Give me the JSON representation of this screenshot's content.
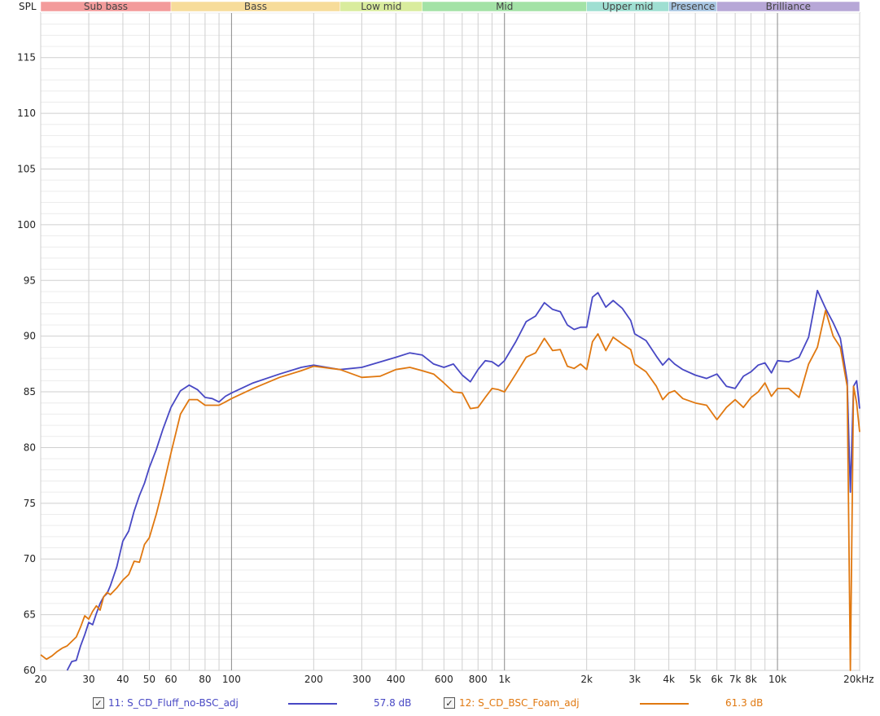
{
  "chart_data": {
    "type": "line",
    "ylabel": "SPL",
    "x_scale": "log",
    "xlim": [
      20,
      20000
    ],
    "ylim": [
      60,
      119
    ],
    "yticks": [
      60,
      65,
      70,
      75,
      80,
      85,
      90,
      95,
      100,
      105,
      110,
      115
    ],
    "xticks": [
      {
        "value": 20,
        "label": "20"
      },
      {
        "value": 30,
        "label": "30"
      },
      {
        "value": 40,
        "label": "40"
      },
      {
        "value": 50,
        "label": "50"
      },
      {
        "value": 60,
        "label": "60"
      },
      {
        "value": 80,
        "label": "80"
      },
      {
        "value": 100,
        "label": "100"
      },
      {
        "value": 200,
        "label": "200"
      },
      {
        "value": 300,
        "label": "300"
      },
      {
        "value": 400,
        "label": "400"
      },
      {
        "value": 600,
        "label": "600"
      },
      {
        "value": 800,
        "label": "800"
      },
      {
        "value": 1000,
        "label": "1k"
      },
      {
        "value": 2000,
        "label": "2k"
      },
      {
        "value": 3000,
        "label": "3k"
      },
      {
        "value": 4000,
        "label": "4k"
      },
      {
        "value": 5000,
        "label": "5k"
      },
      {
        "value": 6000,
        "label": "6k"
      },
      {
        "value": 7000,
        "label": "7k"
      },
      {
        "value": 8000,
        "label": "8k"
      },
      {
        "value": 10000,
        "label": "10k"
      },
      {
        "value": 20000,
        "label": "20kHz"
      }
    ],
    "grid": true,
    "bands": [
      {
        "label": "Sub bass",
        "from": 20,
        "to": 60,
        "color": "#f39b9b"
      },
      {
        "label": "Bass",
        "from": 60,
        "to": 250,
        "color": "#f7dc9a"
      },
      {
        "label": "Low mid",
        "from": 250,
        "to": 500,
        "color": "#d9ec9d"
      },
      {
        "label": "Mid",
        "from": 500,
        "to": 2000,
        "color": "#a3e2a6"
      },
      {
        "label": "Upper mid",
        "from": 2000,
        "to": 4000,
        "color": "#9fdfd2"
      },
      {
        "label": "Presence",
        "from": 4000,
        "to": 6000,
        "color": "#a7c5e2"
      },
      {
        "label": "Brilliance",
        "from": 6000,
        "to": 20000,
        "color": "#b7a7d7"
      }
    ],
    "series": [
      {
        "name": "11: S_CD_Fluff_no-BSC_adj",
        "value_label": "57.8 dB",
        "color": "#4848c4",
        "points": [
          [
            25,
            60
          ],
          [
            26,
            60.8
          ],
          [
            27,
            60.9
          ],
          [
            28,
            62.2
          ],
          [
            29,
            63.2
          ],
          [
            30,
            64.3
          ],
          [
            31,
            64.1
          ],
          [
            32,
            65.1
          ],
          [
            33,
            66.0
          ],
          [
            34,
            66.6
          ],
          [
            35,
            66.9
          ],
          [
            36,
            67.6
          ],
          [
            38,
            69.3
          ],
          [
            40,
            71.6
          ],
          [
            42,
            72.5
          ],
          [
            44,
            74.3
          ],
          [
            46,
            75.7
          ],
          [
            48,
            76.8
          ],
          [
            50,
            78.2
          ],
          [
            53,
            79.8
          ],
          [
            56,
            81.6
          ],
          [
            60,
            83.6
          ],
          [
            65,
            85.1
          ],
          [
            70,
            85.6
          ],
          [
            75,
            85.2
          ],
          [
            80,
            84.5
          ],
          [
            85,
            84.4
          ],
          [
            90,
            84.1
          ],
          [
            95,
            84.6
          ],
          [
            100,
            84.9
          ],
          [
            120,
            85.8
          ],
          [
            150,
            86.6
          ],
          [
            180,
            87.2
          ],
          [
            200,
            87.4
          ],
          [
            250,
            87.0
          ],
          [
            300,
            87.2
          ],
          [
            400,
            88.1
          ],
          [
            450,
            88.5
          ],
          [
            500,
            88.3
          ],
          [
            550,
            87.5
          ],
          [
            600,
            87.2
          ],
          [
            650,
            87.5
          ],
          [
            700,
            86.5
          ],
          [
            750,
            85.9
          ],
          [
            800,
            87.0
          ],
          [
            850,
            87.8
          ],
          [
            900,
            87.7
          ],
          [
            950,
            87.3
          ],
          [
            1000,
            87.8
          ],
          [
            1100,
            89.5
          ],
          [
            1200,
            91.3
          ],
          [
            1300,
            91.8
          ],
          [
            1400,
            93.0
          ],
          [
            1500,
            92.4
          ],
          [
            1600,
            92.2
          ],
          [
            1700,
            91.0
          ],
          [
            1800,
            90.6
          ],
          [
            1900,
            90.8
          ],
          [
            2000,
            90.8
          ],
          [
            2100,
            93.5
          ],
          [
            2200,
            93.9
          ],
          [
            2350,
            92.6
          ],
          [
            2500,
            93.2
          ],
          [
            2700,
            92.5
          ],
          [
            2900,
            91.4
          ],
          [
            3000,
            90.2
          ],
          [
            3300,
            89.6
          ],
          [
            3600,
            88.2
          ],
          [
            3800,
            87.4
          ],
          [
            4000,
            88.0
          ],
          [
            4200,
            87.5
          ],
          [
            4500,
            87.0
          ],
          [
            5000,
            86.5
          ],
          [
            5500,
            86.2
          ],
          [
            6000,
            86.6
          ],
          [
            6500,
            85.5
          ],
          [
            7000,
            85.3
          ],
          [
            7500,
            86.4
          ],
          [
            8000,
            86.8
          ],
          [
            8500,
            87.4
          ],
          [
            9000,
            87.6
          ],
          [
            9500,
            86.7
          ],
          [
            10000,
            87.8
          ],
          [
            11000,
            87.7
          ],
          [
            12000,
            88.1
          ],
          [
            13000,
            89.9
          ],
          [
            14000,
            94.1
          ],
          [
            15000,
            92.5
          ],
          [
            16000,
            91.2
          ],
          [
            17000,
            89.8
          ],
          [
            18000,
            86.0
          ],
          [
            18500,
            76.0
          ],
          [
            19000,
            85.5
          ],
          [
            19500,
            86.0
          ],
          [
            20000,
            83.5
          ]
        ]
      },
      {
        "name": "12: S_CD_BSC_Foam_adj",
        "value_label": "61.3 dB",
        "color": "#e07810",
        "points": [
          [
            20,
            61.4
          ],
          [
            21,
            61.0
          ],
          [
            22,
            61.3
          ],
          [
            23,
            61.7
          ],
          [
            24,
            62.0
          ],
          [
            25,
            62.2
          ],
          [
            26,
            62.6
          ],
          [
            27,
            63.0
          ],
          [
            28,
            63.9
          ],
          [
            29,
            64.9
          ],
          [
            30,
            64.6
          ],
          [
            31,
            65.3
          ],
          [
            32,
            65.8
          ],
          [
            33,
            65.4
          ],
          [
            34,
            66.6
          ],
          [
            35,
            67.0
          ],
          [
            36,
            66.8
          ],
          [
            38,
            67.4
          ],
          [
            40,
            68.1
          ],
          [
            42,
            68.6
          ],
          [
            44,
            69.8
          ],
          [
            46,
            69.7
          ],
          [
            48,
            71.3
          ],
          [
            50,
            71.9
          ],
          [
            53,
            74.0
          ],
          [
            56,
            76.3
          ],
          [
            60,
            79.5
          ],
          [
            65,
            83.0
          ],
          [
            70,
            84.3
          ],
          [
            75,
            84.3
          ],
          [
            80,
            83.8
          ],
          [
            85,
            83.8
          ],
          [
            90,
            83.8
          ],
          [
            95,
            84.1
          ],
          [
            100,
            84.4
          ],
          [
            120,
            85.3
          ],
          [
            150,
            86.3
          ],
          [
            180,
            86.9
          ],
          [
            200,
            87.3
          ],
          [
            250,
            87.0
          ],
          [
            300,
            86.3
          ],
          [
            350,
            86.4
          ],
          [
            400,
            87.0
          ],
          [
            450,
            87.2
          ],
          [
            500,
            86.9
          ],
          [
            550,
            86.6
          ],
          [
            600,
            85.8
          ],
          [
            650,
            85.0
          ],
          [
            700,
            84.9
          ],
          [
            750,
            83.5
          ],
          [
            800,
            83.6
          ],
          [
            850,
            84.5
          ],
          [
            900,
            85.3
          ],
          [
            950,
            85.2
          ],
          [
            1000,
            85.0
          ],
          [
            1100,
            86.6
          ],
          [
            1200,
            88.1
          ],
          [
            1300,
            88.5
          ],
          [
            1400,
            89.8
          ],
          [
            1500,
            88.7
          ],
          [
            1600,
            88.8
          ],
          [
            1700,
            87.3
          ],
          [
            1800,
            87.1
          ],
          [
            1900,
            87.5
          ],
          [
            2000,
            87.0
          ],
          [
            2100,
            89.5
          ],
          [
            2200,
            90.2
          ],
          [
            2350,
            88.7
          ],
          [
            2500,
            89.9
          ],
          [
            2700,
            89.3
          ],
          [
            2900,
            88.8
          ],
          [
            3000,
            87.5
          ],
          [
            3300,
            86.8
          ],
          [
            3600,
            85.5
          ],
          [
            3800,
            84.3
          ],
          [
            4000,
            84.9
          ],
          [
            4200,
            85.1
          ],
          [
            4500,
            84.4
          ],
          [
            5000,
            84.0
          ],
          [
            5500,
            83.8
          ],
          [
            6000,
            82.5
          ],
          [
            6500,
            83.6
          ],
          [
            7000,
            84.3
          ],
          [
            7500,
            83.6
          ],
          [
            8000,
            84.5
          ],
          [
            8500,
            85.0
          ],
          [
            9000,
            85.8
          ],
          [
            9500,
            84.6
          ],
          [
            10000,
            85.3
          ],
          [
            11000,
            85.3
          ],
          [
            12000,
            84.5
          ],
          [
            13000,
            87.5
          ],
          [
            14000,
            89.0
          ],
          [
            15000,
            92.3
          ],
          [
            16000,
            90.0
          ],
          [
            17000,
            89.0
          ],
          [
            18000,
            85.5
          ],
          [
            18500,
            60
          ],
          [
            19000,
            85.5
          ],
          [
            19500,
            84.0
          ],
          [
            20000,
            81.4
          ]
        ]
      }
    ]
  }
}
